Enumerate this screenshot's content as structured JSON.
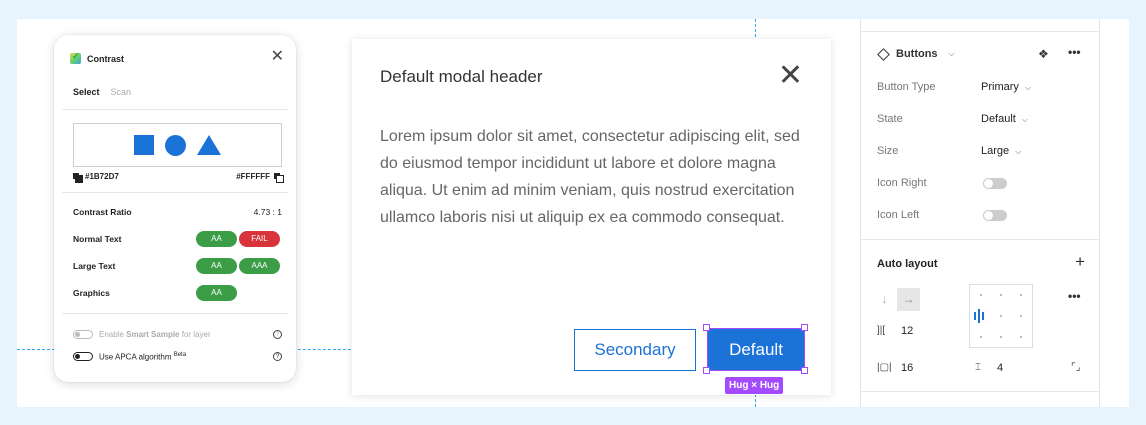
{
  "contrast": {
    "title": "Contrast",
    "tabs": [
      "Select",
      "Scan"
    ],
    "foreground": "#1B72D7",
    "background": "#FFFFFF",
    "ratio_label": "Contrast Ratio",
    "ratio_value": "4.73 : 1",
    "rows": [
      {
        "label": "Normal Text",
        "badges": [
          {
            "text": "AA",
            "status": "pass"
          },
          {
            "text": "FAIL",
            "status": "fail"
          }
        ]
      },
      {
        "label": "Large Text",
        "badges": [
          {
            "text": "AA",
            "status": "pass"
          },
          {
            "text": "AAA",
            "status": "pass"
          }
        ]
      },
      {
        "label": "Graphics",
        "badges": [
          {
            "text": "AA",
            "status": "pass"
          }
        ]
      }
    ],
    "smart_sample_prefix": "Enable ",
    "smart_sample_bold": "Smart Sample",
    "smart_sample_suffix": " for layer",
    "apca_label": "Use APCA algorithm",
    "apca_badge": "Beta"
  },
  "modal": {
    "header": "Default modal header",
    "body": "Lorem ipsum dolor sit amet, consectetur adipiscing elit, sed do eiusmod tempor incididunt ut labore et dolore magna aliqua. Ut enim ad minim veniam, quis nostrud exercitation ullamco laboris nisi ut aliquip ex ea commodo consequat.",
    "secondary_label": "Secondary",
    "primary_label": "Default",
    "hug_label": "Hug × Hug"
  },
  "panel": {
    "component_name": "Buttons",
    "properties": [
      {
        "label": "Button Type",
        "value": "Primary",
        "kind": "select"
      },
      {
        "label": "State",
        "value": "Default",
        "kind": "select"
      },
      {
        "label": "Size",
        "value": "Large",
        "kind": "select"
      },
      {
        "label": "Icon Right",
        "value": "",
        "kind": "toggle"
      },
      {
        "label": "Icon Left",
        "value": "",
        "kind": "toggle"
      }
    ],
    "auto_layout_title": "Auto layout",
    "gap": "12",
    "padding_h": "16",
    "padding_v": "4"
  },
  "colors": {
    "brand": "#1b72d7",
    "selection": "#a54bff",
    "pass": "#3c9d47",
    "fail": "#d9343b",
    "guide": "#34a8e6"
  }
}
